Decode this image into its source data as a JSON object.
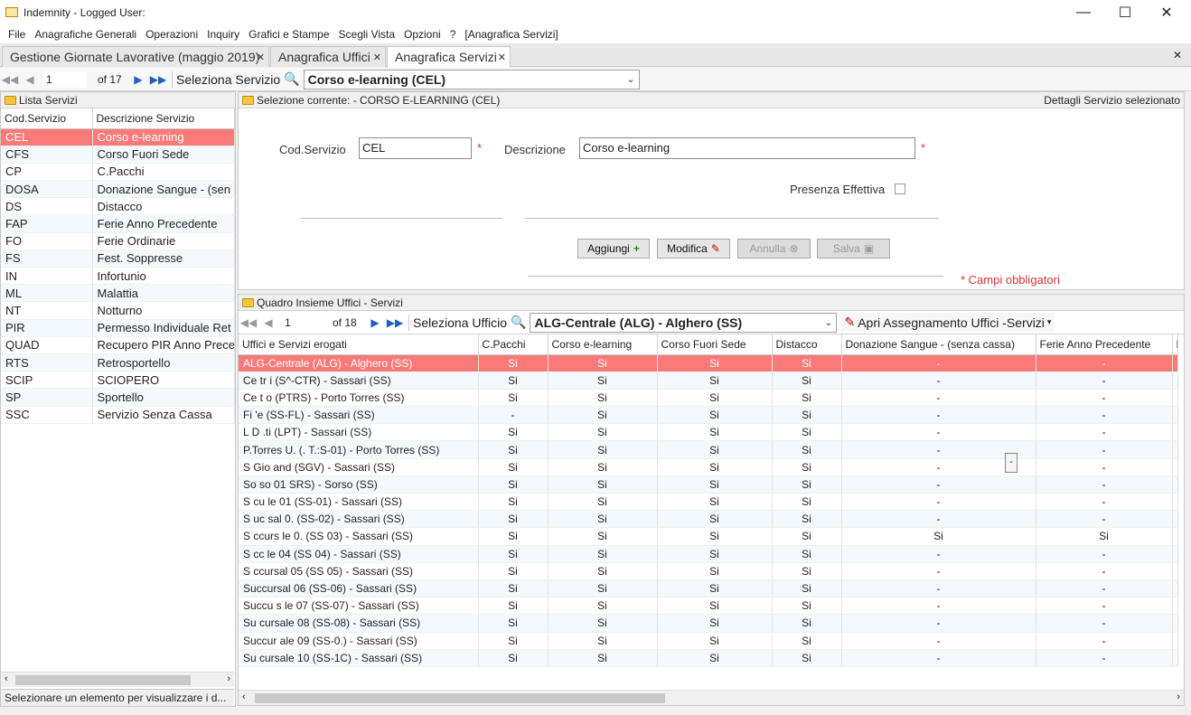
{
  "window": {
    "title": "Indemnity - Logged User:",
    "min_icon": "minimize-icon",
    "max_icon": "maximize-icon",
    "close_icon": "close-icon"
  },
  "menu": [
    "File",
    "Anagrafiche Generali",
    "Operazioni",
    "Inquiry",
    "Grafici e Stampe",
    "Scegli Vista",
    "Opzioni",
    "?",
    "[Anagrafica Servizi]"
  ],
  "tabs": [
    {
      "label": "Gestione Giornate Lavorative (maggio 2019)"
    },
    {
      "label": "Anagrafica Uffici"
    },
    {
      "label": "Anagrafica Servizi"
    }
  ],
  "toolbar": {
    "page": "1",
    "of": "of 17",
    "select_label": "Seleziona Servizio",
    "combo_value": "Corso e-learning (CEL)"
  },
  "left": {
    "header": "Lista Servizi",
    "columns": [
      "Cod.Servizio",
      "Descrizione Servizio"
    ],
    "rows": [
      [
        "CEL",
        "Corso e-learning"
      ],
      [
        "CFS",
        "Corso Fuori Sede"
      ],
      [
        "CP",
        "C.Pacchi"
      ],
      [
        "DOSA",
        "Donazione Sangue - (sen"
      ],
      [
        "DS",
        "Distacco"
      ],
      [
        "FAP",
        "Ferie Anno Precedente"
      ],
      [
        "FO",
        "Ferie Ordinarie"
      ],
      [
        "FS",
        "Fest. Soppresse"
      ],
      [
        "IN",
        "Infortunio"
      ],
      [
        "ML",
        "Malattia"
      ],
      [
        "NT",
        "Notturno"
      ],
      [
        "PIR",
        "Permesso Individuale Ret"
      ],
      [
        "QUAD",
        "Recupero PIR Anno Prece"
      ],
      [
        "RTS",
        "Retrosportello"
      ],
      [
        "SCIP",
        "SCIOPERO"
      ],
      [
        "SP",
        "Sportello"
      ],
      [
        "SSC",
        "Servizio Senza Cassa"
      ]
    ],
    "status": "Selezionare un elemento per visualizzare i d..."
  },
  "detail": {
    "header": "Selezione corrente: - CORSO E-LEARNING (CEL)",
    "header_right": "Dettagli Servizio selezionato",
    "cod_label": "Cod.Servizio",
    "cod_value": "CEL",
    "desc_label": "Descrizione",
    "desc_value": "Corso e-learning",
    "req": "*",
    "presenza_label": "Presenza Effettiva",
    "btn_add": "Aggiungi",
    "btn_edit": "Modifica",
    "btn_cancel": "Annulla",
    "btn_save": "Salva",
    "required_note": "* Campi obbligatori"
  },
  "quadro": {
    "header": "Quadro Insieme Uffici - Servizi",
    "page": "1",
    "of": "of 18",
    "select_label": "Seleziona Ufficio",
    "combo_value": "ALG-Centrale (ALG)  -  Alghero (SS)",
    "assign": "Apri Assegnamento Uffici -Servizi",
    "columns": [
      "Uffici e Servizi erogati",
      "C.Pacchi",
      "Corso e-learning",
      "Corso Fuori Sede",
      "Distacco",
      "Donazione Sangue - (senza cassa)",
      "Ferie Anno Precedente",
      "Fe"
    ],
    "rows": [
      [
        "ALG-Centrale (ALG)  -  Alghero (SS)",
        "Si",
        "Si",
        "Si",
        "Si",
        "-",
        "-",
        ""
      ],
      [
        "Ce  tr  i (S^-CTR)  -  Sassari (SS)",
        "Si",
        "Si",
        "Si",
        "Si",
        "-",
        "-",
        ""
      ],
      [
        "Ce  t  o (PTRS)  -  Porto Torres (SS)",
        "Si",
        "Si",
        "Si",
        "Si",
        "-",
        "-",
        ""
      ],
      [
        "Fi  'e (SS-FL)  -  Sassari (SS)",
        "-",
        "Si",
        "Si",
        "Si",
        "-",
        "-",
        ""
      ],
      [
        "L  D  .ti (LPT)  -  Sassari (SS)",
        "Si",
        "Si",
        "Si",
        "Si",
        "-",
        "-",
        ""
      ],
      [
        "P.Torres U. (. T.:S-01)  -  Porto Torres (SS)",
        "Si",
        "Si",
        "Si",
        "Si",
        "-",
        "-",
        ""
      ],
      [
        "S Gio  and  (SGV)  -  Sassari (SS)",
        "Si",
        "Si",
        "Si",
        "Si",
        "-",
        "-",
        ""
      ],
      [
        "So  so  01 SRS)  -  Sorso (SS)",
        "Si",
        "Si",
        "Si",
        "Si",
        "-",
        "-",
        ""
      ],
      [
        "S  cu  le 01 (SS-01)  -  Sassari (SS)",
        "Si",
        "Si",
        "Si",
        "Si",
        "-",
        "-",
        ""
      ],
      [
        "S  uc  sal  0. (SS-02)  -  Sassari (SS)",
        "Si",
        "Si",
        "Si",
        "Si",
        "-",
        "-",
        ""
      ],
      [
        "S  ccurs  le 0. (SS 03)  -  Sassari (SS)",
        "Si",
        "Si",
        "Si",
        "Si",
        "Si",
        "Si",
        ""
      ],
      [
        "S  cc  le 04 (SS 04)  -  Sassari (SS)",
        "Si",
        "Si",
        "Si",
        "Si",
        "-",
        "-",
        ""
      ],
      [
        "S  ccursal  05 (SS 05)  -  Sassari (SS)",
        "Si",
        "Si",
        "Si",
        "Si",
        "-",
        "-",
        ""
      ],
      [
        "Succursal  06 (SS-06)  -  Sassari (SS)",
        "Si",
        "Si",
        "Si",
        "Si",
        "-",
        "-",
        ""
      ],
      [
        "Succu  s  le 07 (SS-07)  -  Sassari (SS)",
        "Si",
        "Si",
        "Si",
        "Si",
        "-",
        "-",
        ""
      ],
      [
        "Su  cursale 08 (SS-08)  -  Sassari (SS)",
        "Si",
        "Si",
        "Si",
        "Si",
        "-",
        "-",
        ""
      ],
      [
        "Succur  ale 09 (SS-0.)  -  Sassari (SS)",
        "Si",
        "Si",
        "Si",
        "Si",
        "-",
        "-",
        ""
      ],
      [
        "Su  cursale 10 (SS-1C)  -  Sassari (SS)",
        "Si",
        "Si",
        "Si",
        "Si",
        "-",
        "-",
        ""
      ]
    ],
    "float_btn": "-"
  }
}
